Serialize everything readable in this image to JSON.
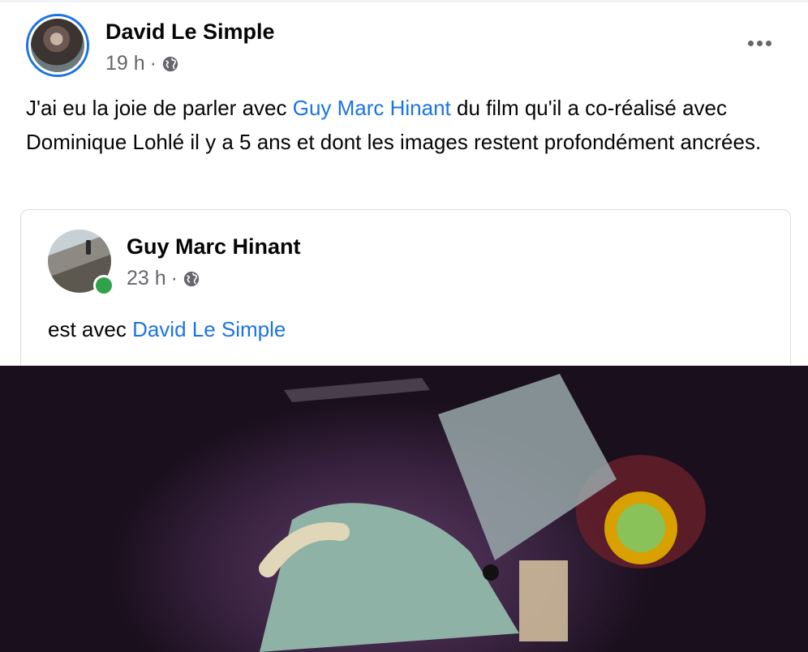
{
  "post": {
    "author": "David Le Simple",
    "time": "19 h",
    "separator": "·",
    "text_parts": {
      "before": "J'ai eu la joie de parler avec ",
      "mention": "Guy Marc Hinant",
      "after": " du film qu'il a co-réalisé avec Dominique Lohlé il y a 5 ans et dont les images restent profondément ancrées."
    },
    "privacy_icon": "globe-icon",
    "more_icon": "more-horizontal-icon"
  },
  "shared": {
    "author": "Guy Marc Hinant",
    "time": "23 h",
    "separator": "·",
    "text_before": "est avec ",
    "mention": "David Le Simple",
    "privacy_icon": "globe-icon",
    "online": true
  },
  "colors": {
    "link": "#1b74e4",
    "secondary_text": "#65676b",
    "online": "#31a24c",
    "border": "#dadde1"
  }
}
